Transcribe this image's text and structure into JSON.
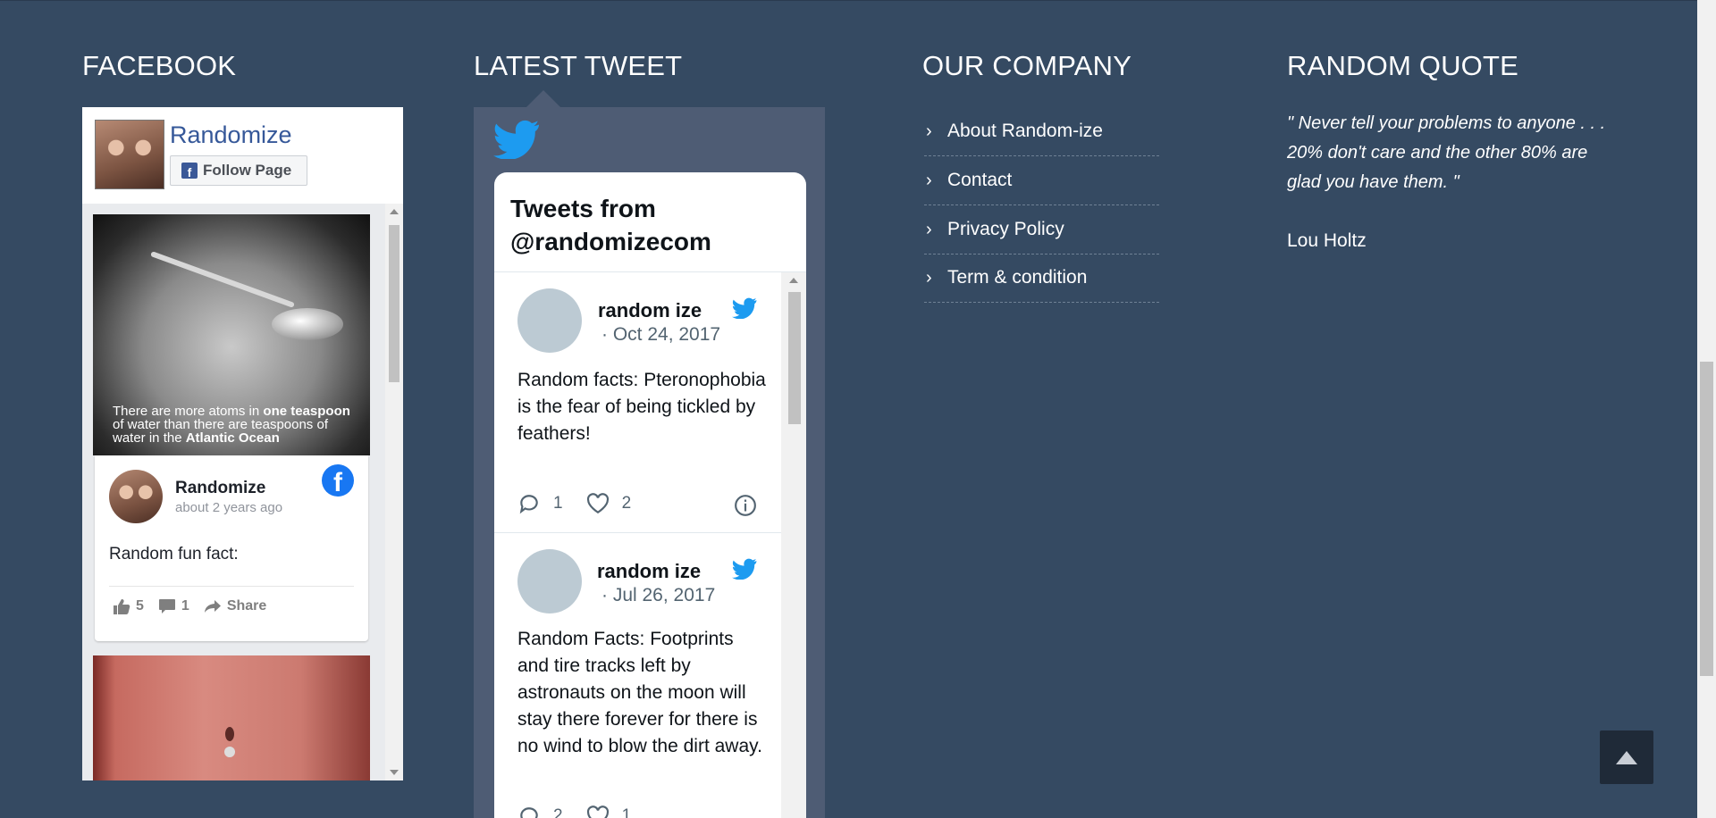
{
  "columns": {
    "facebook": "FACEBOOK",
    "latest_tweet": "LATEST TWEET",
    "our_company": "OUR COMPANY",
    "random_quote": "RANDOM QUOTE"
  },
  "facebook_widget": {
    "page_name": "Randomize",
    "follow_label": "Follow Page",
    "post": {
      "image_caption_parts": [
        "There are more atoms in ",
        "one teaspoon",
        " of water than there are teaspoons of water in the ",
        "Atlantic Ocean"
      ],
      "author": "Randomize",
      "time": "about 2 years ago",
      "text": "Random fun fact:",
      "likes": "5",
      "comments": "1",
      "share_label": "Share"
    }
  },
  "twitter_widget": {
    "title": "Tweets from @randomizecom",
    "tweets": [
      {
        "name": "random ize",
        "date": "· Oct 24, 2017",
        "text": "Random facts: Pteronophobia is the fear of being tickled by feathers!",
        "replies": "1",
        "likes": "2"
      },
      {
        "name": "random ize",
        "date": "· Jul 26, 2017",
        "text": "Random Facts: Footprints and tire tracks left by astronauts on the moon will stay there forever for there is no wind to blow the dirt away.",
        "replies": "2",
        "likes": "1"
      }
    ]
  },
  "company_links": [
    "About Random-ize",
    "Contact",
    "Privacy Policy",
    "Term & condition"
  ],
  "quote": {
    "text": "\" Never tell your problems to anyone . . . 20% don't care and the other 80% are glad you have them. \"",
    "author": "Lou Holtz"
  },
  "icons": {
    "twitter": "twitter-bird-icon",
    "facebook": "facebook-logo-icon",
    "back_to_top": "arrow-up-icon"
  },
  "colors": {
    "background": "#354a62",
    "twitter_panel": "#4e5c74",
    "twitter_blue": "#1d9bf0",
    "facebook_blue": "#1877f2",
    "facebook_link": "#365899"
  }
}
